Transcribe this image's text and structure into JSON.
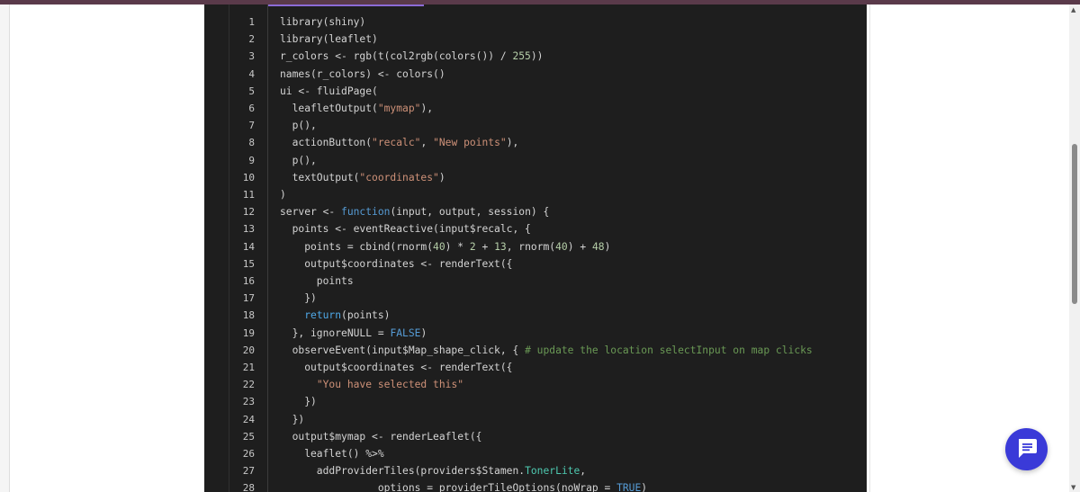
{
  "editor": {
    "line_numbers": [
      "1",
      "2",
      "3",
      "4",
      "5",
      "6",
      "7",
      "8",
      "9",
      "10",
      "11",
      "12",
      "13",
      "14",
      "15",
      "16",
      "17",
      "18",
      "19",
      "20",
      "21",
      "22",
      "23",
      "24",
      "25",
      "26",
      "27",
      "28"
    ],
    "lines": [
      [
        {
          "t": "library(shiny)",
          "c": "fn"
        }
      ],
      [
        {
          "t": "library(leaflet)",
          "c": "fn"
        }
      ],
      [
        {
          "t": "r_colors <- rgb(t(col2rgb(colors()) / ",
          "c": "op"
        },
        {
          "t": "255",
          "c": "num"
        },
        {
          "t": "))",
          "c": "op"
        }
      ],
      [
        {
          "t": "names(r_colors) <- colors()",
          "c": "op"
        }
      ],
      [
        {
          "t": "ui <- fluidPage(",
          "c": "op"
        }
      ],
      [
        {
          "t": "  leafletOutput(",
          "c": "op"
        },
        {
          "t": "\"mymap\"",
          "c": "str"
        },
        {
          "t": "),",
          "c": "op"
        }
      ],
      [
        {
          "t": "  p(),",
          "c": "op"
        }
      ],
      [
        {
          "t": "  actionButton(",
          "c": "op"
        },
        {
          "t": "\"recalc\"",
          "c": "str"
        },
        {
          "t": ", ",
          "c": "op"
        },
        {
          "t": "\"New points\"",
          "c": "str"
        },
        {
          "t": "),",
          "c": "op"
        }
      ],
      [
        {
          "t": "  p(),",
          "c": "op"
        }
      ],
      [
        {
          "t": "  textOutput(",
          "c": "op"
        },
        {
          "t": "\"coordinates\"",
          "c": "str"
        },
        {
          "t": ")",
          "c": "op"
        }
      ],
      [
        {
          "t": ")",
          "c": "op"
        }
      ],
      [
        {
          "t": "server <- ",
          "c": "op"
        },
        {
          "t": "function",
          "c": "kw"
        },
        {
          "t": "(input, output, session) {",
          "c": "op"
        }
      ],
      [
        {
          "t": "  points <- eventReactive(input$recalc, {",
          "c": "op"
        }
      ],
      [
        {
          "t": "    points = cbind(rnorm(",
          "c": "op"
        },
        {
          "t": "40",
          "c": "num"
        },
        {
          "t": ") * ",
          "c": "op"
        },
        {
          "t": "2",
          "c": "num"
        },
        {
          "t": " + ",
          "c": "op"
        },
        {
          "t": "13",
          "c": "num"
        },
        {
          "t": ", rnorm(",
          "c": "op"
        },
        {
          "t": "40",
          "c": "num"
        },
        {
          "t": ") + ",
          "c": "op"
        },
        {
          "t": "48",
          "c": "num"
        },
        {
          "t": ")",
          "c": "op"
        }
      ],
      [
        {
          "t": "    output$coordinates <- renderText({",
          "c": "op"
        }
      ],
      [
        {
          "t": "      points",
          "c": "op"
        }
      ],
      [
        {
          "t": "    })",
          "c": "op"
        }
      ],
      [
        {
          "t": "    ",
          "c": "op"
        },
        {
          "t": "return",
          "c": "ret"
        },
        {
          "t": "(points)",
          "c": "op"
        }
      ],
      [
        {
          "t": "  }, ignoreNULL = ",
          "c": "op"
        },
        {
          "t": "FALSE",
          "c": "kw"
        },
        {
          "t": ")",
          "c": "op"
        }
      ],
      [
        {
          "t": "  observeEvent(input$Map_shape_click, { ",
          "c": "op"
        },
        {
          "t": "# update the location selectInput on map clicks",
          "c": "com"
        }
      ],
      [
        {
          "t": "    output$coordinates <- renderText({",
          "c": "op"
        }
      ],
      [
        {
          "t": "      ",
          "c": "op"
        },
        {
          "t": "\"You have selected this\"",
          "c": "str"
        }
      ],
      [
        {
          "t": "    })",
          "c": "op"
        }
      ],
      [
        {
          "t": "  })",
          "c": "op"
        }
      ],
      [
        {
          "t": "  output$mymap <- renderLeaflet({",
          "c": "op"
        }
      ],
      [
        {
          "t": "    leaflet() %>%",
          "c": "op"
        }
      ],
      [
        {
          "t": "      addProviderTiles(providers$Stamen.",
          "c": "op"
        },
        {
          "t": "TonerLite",
          "c": "cls"
        },
        {
          "t": ",",
          "c": "op"
        }
      ],
      [
        {
          "t": "                options = providerTileOptions(noWrap = ",
          "c": "op"
        },
        {
          "t": "TRUE",
          "c": "kw"
        },
        {
          "t": ")",
          "c": "op"
        }
      ]
    ]
  },
  "toolbar": {
    "copy_icon": "copy-icon",
    "menu_icon": "list-icon"
  },
  "chat": {
    "icon": "chat-bubble-icon",
    "color": "#3a3ad8"
  },
  "theme": {
    "editor_bg": "#1e1e1e",
    "accent": "#8c6bd6"
  }
}
